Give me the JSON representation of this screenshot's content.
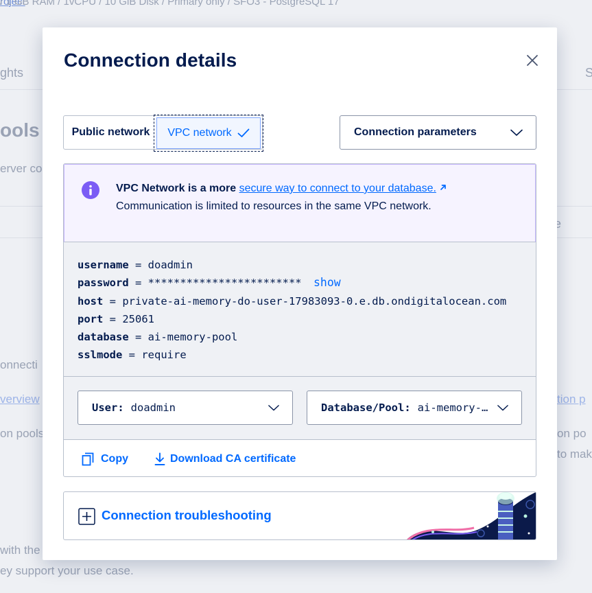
{
  "background": {
    "breadcrumb_link": "roject",
    "breadcrumb_rest": " / 1 GB RAM / 1vCPU / 10 GiB Disk / Primary only / SFO3 - PostgreSQL 17",
    "tab_fragment": "ghts",
    "tab_fragment_right": "S",
    "heading_fragment": "ools",
    "text_fragment": "erver co",
    "right_fragment": "e",
    "connections_fragment": "onnecti",
    "overview_fragment": "verview",
    "pool_link_fragment": "tion p",
    "pools_fragment": "on pools",
    "pools_right_fragment": "on po",
    "make_fragment": "to mak",
    "with_fragment": "with the",
    "support_fragment": "ey support your use case."
  },
  "modal": {
    "title": "Connection details",
    "close_icon": "close-icon"
  },
  "network_toggle": {
    "public_label": "Public network",
    "vpc_label": "VPC network",
    "selected": "VPC network"
  },
  "connection_format": {
    "selected": "Connection parameters"
  },
  "info": {
    "lead": "VPC Network is a more ",
    "link": "secure way to connect to your database.",
    "line2": "Communication is limited to resources in the same VPC network.",
    "icon": "info-icon"
  },
  "params": {
    "username_key": "username",
    "username": "doadmin",
    "password_key": "password",
    "password": "************************",
    "show_label": "show",
    "host_key": "host",
    "host": "private-ai-memory-do-user-17983093-0.e.db.ondigitalocean.com",
    "port_key": "port",
    "port": "25061",
    "database_key": "database",
    "database": "ai-memory-pool",
    "sslmode_key": "sslmode",
    "sslmode": "require"
  },
  "selectors": {
    "user_label": "User:",
    "user_value": "doadmin",
    "db_label": "Database/Pool:",
    "db_value": "ai-memory-…"
  },
  "actions": {
    "copy_label": "Copy",
    "download_label": "Download CA certificate"
  },
  "troubleshooting": {
    "label": "Connection troubleshooting"
  },
  "colors": {
    "brand_blue": "#0069ff",
    "navy": "#031b4e",
    "info_purple": "#7b5cf5",
    "info_bg": "#f6f3ff",
    "code_bg": "#eff1f5"
  }
}
